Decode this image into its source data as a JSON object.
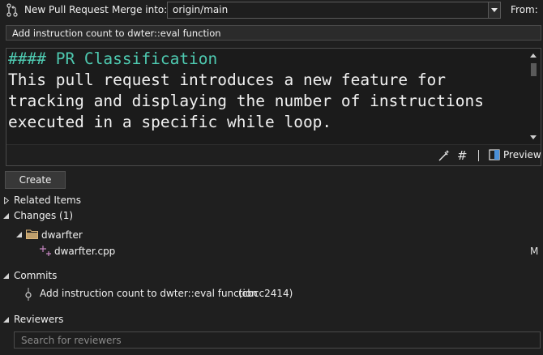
{
  "header": {
    "title": "New Pull Request",
    "merge_into_label": "Merge into:",
    "target_branch": "origin/main",
    "from_label": "From:"
  },
  "pr_title": "Add instruction count to dwter::eval function",
  "description": {
    "heading": "#### PR Classification",
    "lines": [
      "This pull request introduces a new feature for",
      "tracking and displaying the number of instructions",
      "executed in a specific while loop."
    ]
  },
  "editor_toolbar": {
    "preview_label": "Preview",
    "hash_glyph": "#"
  },
  "create_button": "Create",
  "sections": {
    "related_items": "Related Items",
    "changes": "Changes (1)",
    "commits": "Commits",
    "reviewers": "Reviewers"
  },
  "changes": {
    "folder": "dwarfter",
    "file": "dwarfter.cpp",
    "file_status": "M"
  },
  "commits": [
    {
      "message": "Add instruction count to dwter::eval function",
      "sha": "(cbcc2414)"
    }
  ],
  "reviewers": {
    "placeholder": "Search for reviewers"
  },
  "colors": {
    "background": "#1f1f1f",
    "heading_teal": "#4ec9b0",
    "folder_yellow": "#dcb67a",
    "file_added_purple": "#c586c0"
  }
}
